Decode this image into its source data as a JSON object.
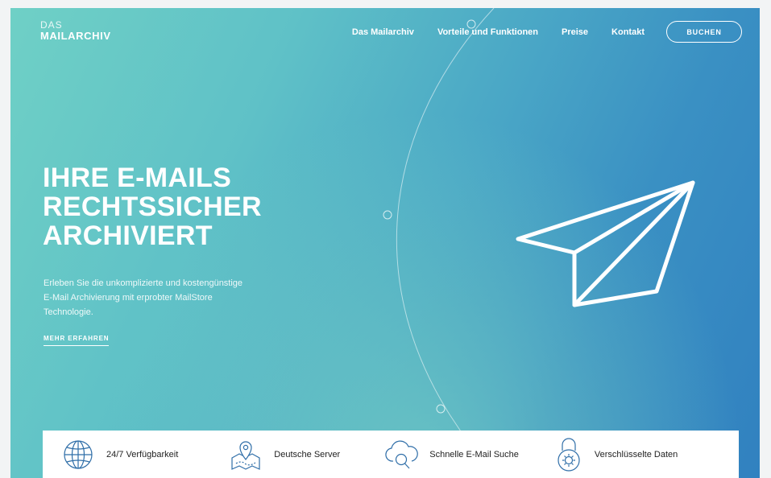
{
  "logo": {
    "small": "DAS",
    "big": "MAILARCHIV"
  },
  "nav": {
    "items": [
      "Das Mailarchiv",
      "Vorteile und Funktionen",
      "Preise",
      "Kontakt"
    ],
    "book_label": "BUCHEN"
  },
  "hero": {
    "title_lines": [
      "IHRE E-MAILS",
      "RECHTSSICHER",
      "ARCHIVIERT"
    ],
    "text_lines": [
      "Erleben Sie die unkomplizierte und kostengünstige",
      "E-Mail Archivierung mit erprobter MailStore",
      "Technologie."
    ],
    "more_label": "MEHR ERFAHREN"
  },
  "features": [
    {
      "icon": "globe-icon",
      "label": "24/7 Verfügbarkeit"
    },
    {
      "icon": "map-pin-icon",
      "label": "Deutsche Server"
    },
    {
      "icon": "cloud-search-icon",
      "label": "Schnelle E-Mail Suche"
    },
    {
      "icon": "padlock-icon",
      "label": "Verschlüsselte Daten"
    }
  ],
  "colors": {
    "gradient_start": "#6fd0c6",
    "gradient_end": "#3181c0",
    "icon_blue": "#2f6ea8"
  }
}
